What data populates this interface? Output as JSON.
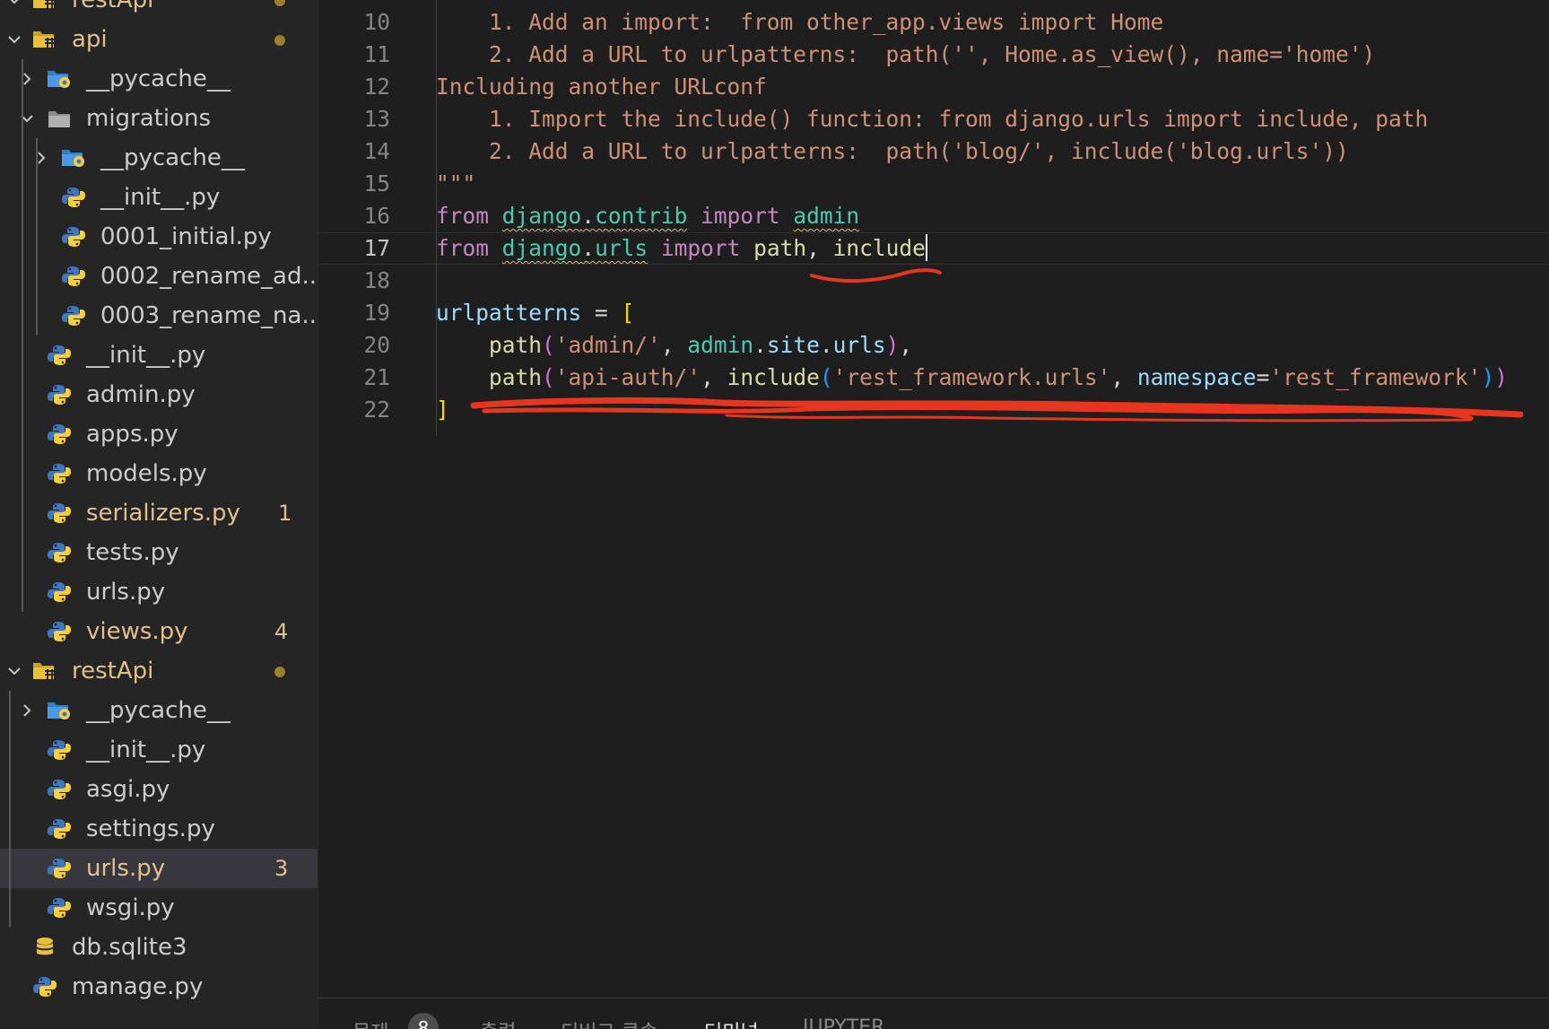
{
  "explorer": {
    "items": [
      {
        "label": "restApi",
        "type": "folder-config",
        "chevron": "down",
        "modified": true,
        "dot": true
      },
      {
        "label": "api",
        "type": "folder-config",
        "chevron": "down",
        "modified": true,
        "dot": true
      },
      {
        "label": "__pycache__",
        "type": "folder-python",
        "chevron": "right"
      },
      {
        "label": "migrations",
        "type": "folder",
        "chevron": "down"
      },
      {
        "label": "__pycache__",
        "type": "folder-python",
        "chevron": "right"
      },
      {
        "label": "__init__.py",
        "type": "python"
      },
      {
        "label": "0001_initial.py",
        "type": "python"
      },
      {
        "label": "0002_rename_ad...",
        "type": "python"
      },
      {
        "label": "0003_rename_na...",
        "type": "python"
      },
      {
        "label": "__init__.py",
        "type": "python"
      },
      {
        "label": "admin.py",
        "type": "python"
      },
      {
        "label": "apps.py",
        "type": "python"
      },
      {
        "label": "models.py",
        "type": "python"
      },
      {
        "label": "serializers.py",
        "type": "python",
        "modified": true,
        "badge": "1"
      },
      {
        "label": "tests.py",
        "type": "python"
      },
      {
        "label": "urls.py",
        "type": "python"
      },
      {
        "label": "views.py",
        "type": "python",
        "modified": true,
        "badge": "4"
      },
      {
        "label": "restApi",
        "type": "folder-config",
        "chevron": "down",
        "modified": true,
        "dot": true
      },
      {
        "label": "__pycache__",
        "type": "folder-python",
        "chevron": "right"
      },
      {
        "label": "__init__.py",
        "type": "python"
      },
      {
        "label": "asgi.py",
        "type": "python"
      },
      {
        "label": "settings.py",
        "type": "python"
      },
      {
        "label": "urls.py",
        "type": "python",
        "modified": true,
        "badge": "3",
        "selected": true
      },
      {
        "label": "wsgi.py",
        "type": "python"
      },
      {
        "label": "db.sqlite3",
        "type": "database"
      },
      {
        "label": "manage.py",
        "type": "python"
      }
    ]
  },
  "editor": {
    "current_line": "17",
    "lines": [
      {
        "number": "10",
        "tokens": [
          [
            "s",
            "    1. Add an import:  from other_app.views import Home"
          ]
        ]
      },
      {
        "number": "11",
        "tokens": [
          [
            "s",
            "    2. Add a URL to urlpatterns:  path('', Home.as_view(), name='home')"
          ]
        ]
      },
      {
        "number": "12",
        "tokens": [
          [
            "s",
            "Including another URLconf"
          ]
        ]
      },
      {
        "number": "13",
        "tokens": [
          [
            "s",
            "    1. Import the include() function: from django.urls import include, path"
          ]
        ]
      },
      {
        "number": "14",
        "tokens": [
          [
            "s",
            "    2. Add a URL to urlpatterns:  path('blog/', include('blog.urls'))"
          ]
        ]
      },
      {
        "number": "15",
        "tokens": [
          [
            "s",
            "\"\"\""
          ]
        ]
      },
      {
        "number": "16",
        "tokens": [
          [
            "k",
            "from"
          ],
          [
            "p",
            " "
          ],
          [
            "m squig",
            "django"
          ],
          [
            "p squig",
            "."
          ],
          [
            "m squig",
            "contrib"
          ],
          [
            "p",
            " "
          ],
          [
            "k",
            "import"
          ],
          [
            "p",
            " "
          ],
          [
            "m squig",
            "admin"
          ]
        ]
      },
      {
        "number": "17",
        "tokens": [
          [
            "k",
            "from"
          ],
          [
            "p",
            " "
          ],
          [
            "m squig",
            "django"
          ],
          [
            "p squig",
            "."
          ],
          [
            "m squig",
            "urls"
          ],
          [
            "p",
            " "
          ],
          [
            "k",
            "import"
          ],
          [
            "p",
            " "
          ],
          [
            "f",
            "path"
          ],
          [
            "p",
            ", "
          ],
          [
            "f",
            "include"
          ],
          [
            "cursor",
            ""
          ]
        ]
      },
      {
        "number": "18",
        "tokens": []
      },
      {
        "number": "19",
        "tokens": [
          [
            "v",
            "urlpatterns"
          ],
          [
            "p",
            " = "
          ],
          [
            "b1",
            "["
          ]
        ]
      },
      {
        "number": "20",
        "tokens": [
          [
            "p",
            "    "
          ],
          [
            "f",
            "path"
          ],
          [
            "b2",
            "("
          ],
          [
            "s",
            "'admin/'"
          ],
          [
            "p",
            ", "
          ],
          [
            "m",
            "admin"
          ],
          [
            "p",
            "."
          ],
          [
            "v",
            "site"
          ],
          [
            "p",
            "."
          ],
          [
            "v",
            "urls"
          ],
          [
            "b2",
            ")"
          ],
          [
            "p",
            ","
          ]
        ]
      },
      {
        "number": "21",
        "tokens": [
          [
            "p",
            "    "
          ],
          [
            "f",
            "path"
          ],
          [
            "b2",
            "("
          ],
          [
            "s",
            "'api-auth/'"
          ],
          [
            "p",
            ", "
          ],
          [
            "f",
            "include"
          ],
          [
            "b3",
            "("
          ],
          [
            "s",
            "'rest_framework.urls'"
          ],
          [
            "p",
            ", "
          ],
          [
            "v",
            "namespace"
          ],
          [
            "p",
            "="
          ],
          [
            "s",
            "'rest_framework'"
          ],
          [
            "b3",
            ")"
          ],
          [
            "b2",
            ")"
          ]
        ]
      },
      {
        "number": "22",
        "tokens": [
          [
            "b1",
            "]"
          ]
        ]
      }
    ]
  },
  "panel": {
    "tabs": [
      {
        "label": "문제",
        "badge": "8"
      },
      {
        "label": "출력"
      },
      {
        "label": "디버그 콘솔"
      },
      {
        "label": "터미널",
        "active": true
      },
      {
        "label": "JUPYTER"
      }
    ]
  },
  "colors": {
    "annotation": "#e8351f",
    "modified": "#e2c08d",
    "python_blue": "#3b78c2",
    "python_yellow": "#f5cf3c"
  }
}
